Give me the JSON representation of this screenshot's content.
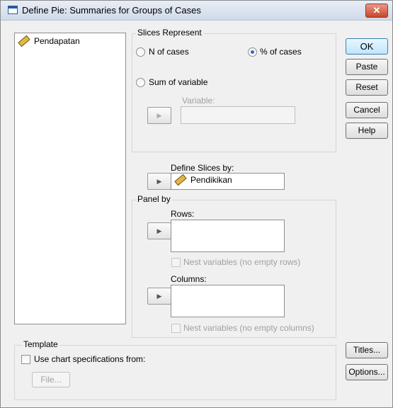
{
  "window": {
    "title": "Define Pie: Summaries for Groups of Cases",
    "close_glyph": "✕"
  },
  "variables": [
    "Pendapatan"
  ],
  "slices_represent": {
    "legend": "Slices Represent",
    "n_of_cases": "N of cases",
    "pct_of_cases": "% of cases",
    "sum_of_variable": "Sum of variable",
    "selected": "pct_of_cases",
    "variable_label": "Variable:",
    "variable_value": ""
  },
  "define_slices": {
    "label": "Define Slices by:",
    "value": "Pendikikan"
  },
  "panel_by": {
    "legend": "Panel by",
    "rows_label": "Rows:",
    "rows_value": "",
    "nest_rows": "Nest variables (no empty rows)",
    "columns_label": "Columns:",
    "columns_value": "",
    "nest_columns": "Nest variables (no empty columns)"
  },
  "template": {
    "legend": "Template",
    "use_spec": "Use chart specifications from:",
    "file_button": "File..."
  },
  "buttons": {
    "ok": "OK",
    "paste": "Paste",
    "reset": "Reset",
    "cancel": "Cancel",
    "help": "Help",
    "titles": "Titles...",
    "options": "Options..."
  },
  "move_arrow": "▶"
}
